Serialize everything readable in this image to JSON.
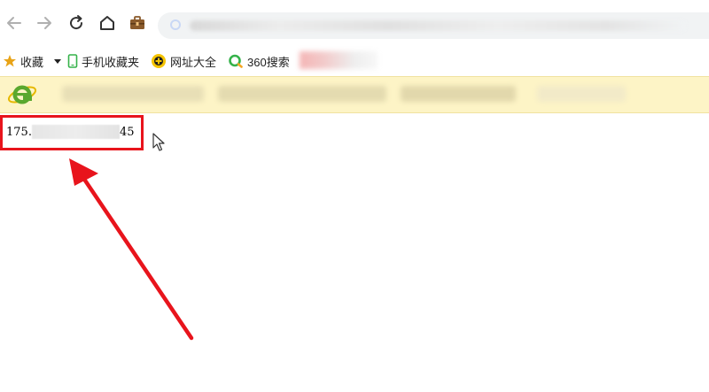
{
  "browser": {
    "back_icon": "arrow-left-icon",
    "forward_icon": "arrow-right-icon",
    "reload_icon": "reload-icon",
    "home_icon": "home-icon",
    "toolbox_icon": "briefcase-icon",
    "address_icon": "globe-icon"
  },
  "bookmarks": {
    "favorites_label": "收藏",
    "mobile_favorites_label": "手机收藏夹",
    "web_directory_label": "网址大全",
    "search_360_label": "360搜索"
  },
  "page": {
    "ip_prefix": "175.",
    "ip_suffix": "45"
  },
  "colors": {
    "highlight": "#e8141c",
    "infobar_bg": "#fdf4c6",
    "star": "#e8a317",
    "ie_logo": "#5aa82e",
    "search_360": "#35b24a"
  }
}
